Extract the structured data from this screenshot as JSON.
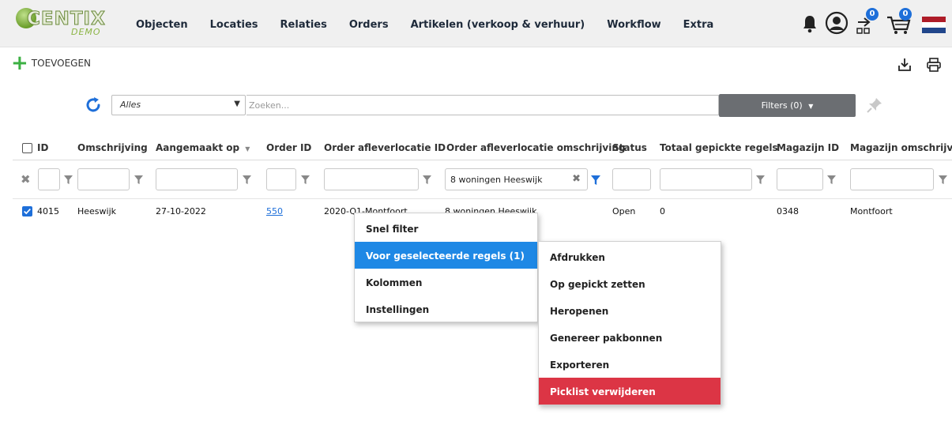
{
  "app": {
    "logo_text": "CENTIX",
    "logo_sub": "DEMO",
    "nav": [
      "Objecten",
      "Locaties",
      "Relaties",
      "Orders",
      "Artikelen (verkoop & verhuur)",
      "Workflow",
      "Extra"
    ],
    "scan_badge": "0",
    "cart_badge": "0",
    "icons": [
      "bell-icon",
      "user-icon",
      "scan-icon",
      "cart-icon",
      "flag-nl-icon"
    ]
  },
  "toolbar": {
    "add_label": "TOEVOEGEN",
    "icons": [
      "download-icon",
      "print-icon"
    ]
  },
  "filterbar": {
    "select_value": "Alles",
    "search_placeholder": "Zoeken...",
    "filters_label": "Filters (0)"
  },
  "table": {
    "columns": [
      "ID",
      "Omschrijving",
      "Aangemaakt op",
      "Order ID",
      "Order afleverlocatie ID",
      "Order afleverlocatie omschrijving",
      "Status",
      "Totaal gepickte regels",
      "Magazijn ID",
      "Magazijn omschrijvi..."
    ],
    "filter_values": {
      "afleverlocatie_omschrijving": "8 woningen Heeswijk"
    },
    "rows": [
      {
        "checked": true,
        "id": "4015",
        "omschrijving": "Heeswijk",
        "aangemaakt": "27-10-2022",
        "order_id": "550",
        "afleverlocatie_id": "2020-Q1-Montfoort",
        "afleverlocatie_omschrijving": "8 woningen Heeswijk",
        "status": "Open",
        "totaal": "0",
        "magazijn_id": "0348",
        "magazijn_omschrijving": "Montfoort"
      }
    ]
  },
  "context_menu": {
    "items": [
      "Snel filter",
      "Voor geselecteerde regels (1)",
      "Kolommen",
      "Instellingen"
    ],
    "active_index": 1
  },
  "submenu": {
    "items": [
      "Afdrukken",
      "Op gepickt zetten",
      "Heropenen",
      "Genereer pakbonnen",
      "Exporteren",
      "Picklist verwijderen"
    ],
    "danger_index": 5
  },
  "colors": {
    "accent": "#1e88e5",
    "danger": "#dc3545",
    "link": "#1e6fd9",
    "filter_button": "#6b6e72",
    "add_plus": "#3cb043"
  }
}
